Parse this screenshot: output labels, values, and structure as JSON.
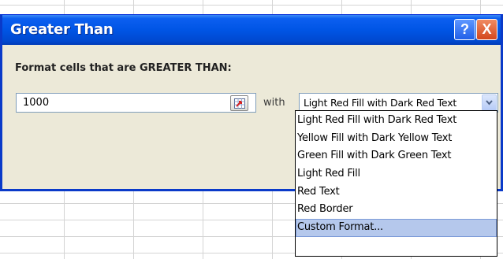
{
  "dialog": {
    "title": "Greater Than",
    "help_glyph": "?",
    "close_glyph": "X",
    "prompt": "Format cells that are GREATER THAN:",
    "value": "1000",
    "with_label": "with",
    "selected_format": "Light Red Fill with Dark Red Text",
    "options": [
      "Light Red Fill with Dark Red Text",
      "Yellow Fill with Dark Yellow Text",
      "Green Fill with Dark Green Text",
      "Light Red Fill",
      "Red Text",
      "Red Border",
      "Custom Format..."
    ],
    "highlighted_option": "Custom Format..."
  },
  "icons": {
    "help": "help-icon",
    "close": "close-icon",
    "range_select": "range-select-icon",
    "dropdown": "chevron-down-icon"
  },
  "colors": {
    "titlebar": "#0055e5",
    "dialog_bg": "#ece9d8",
    "close_button": "#d3471d",
    "highlight": "#b5c8ec"
  }
}
